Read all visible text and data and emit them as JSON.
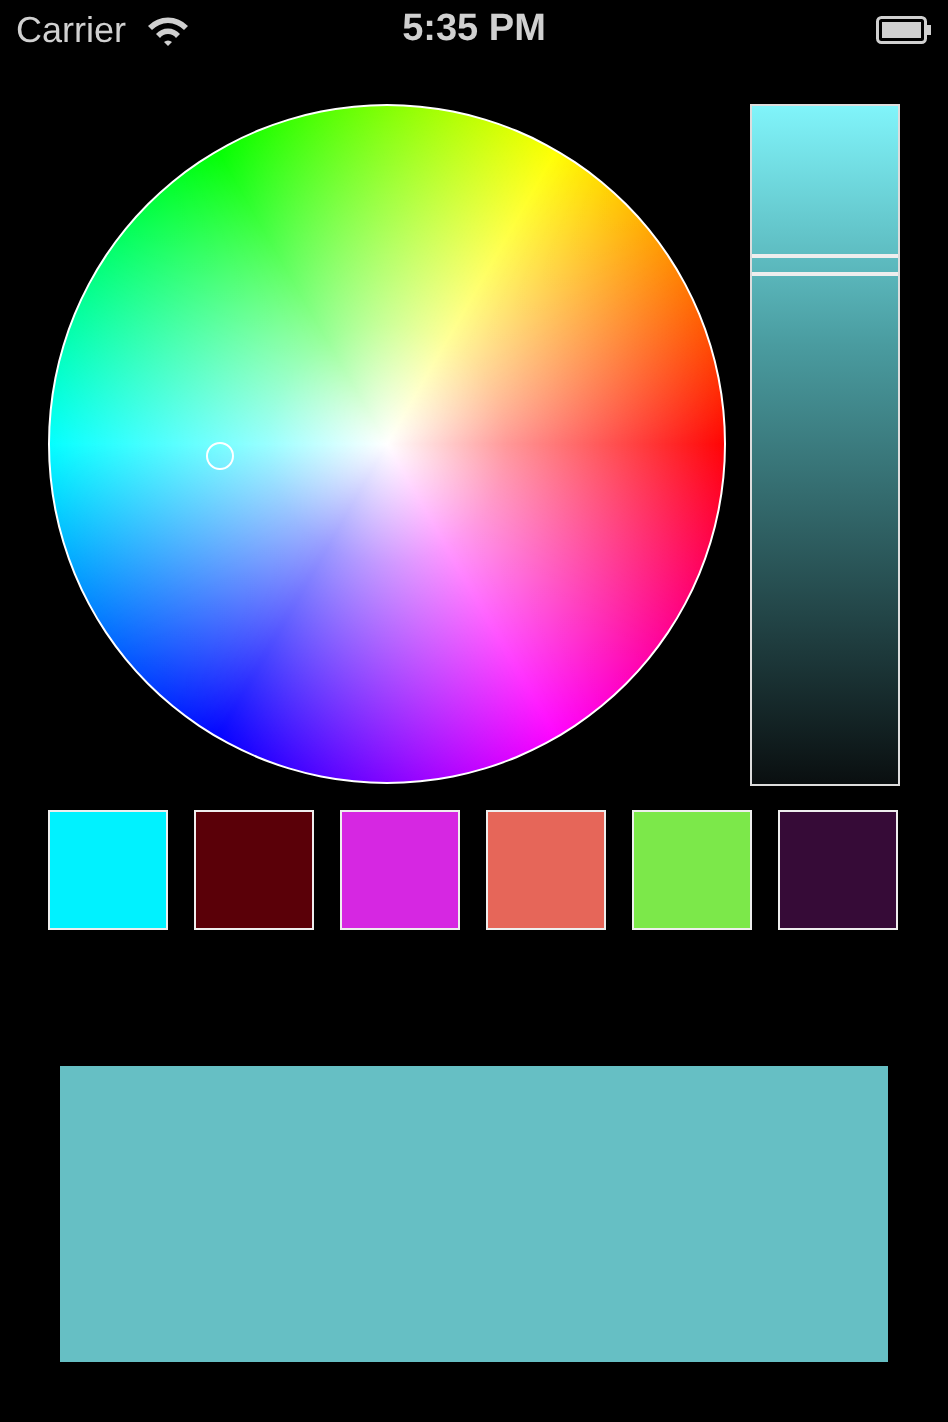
{
  "status_bar": {
    "carrier": "Carrier",
    "time": "5:35 PM"
  },
  "brightness_slider": {
    "level": 0.77
  },
  "swatches": [
    {
      "color": "#00f2ff"
    },
    {
      "color": "#5a0008"
    },
    {
      "color": "#d627e2"
    },
    {
      "color": "#e66659"
    },
    {
      "color": "#7ce84a"
    },
    {
      "color": "#360b37"
    }
  ],
  "preview": {
    "color": "#66bfc4"
  }
}
